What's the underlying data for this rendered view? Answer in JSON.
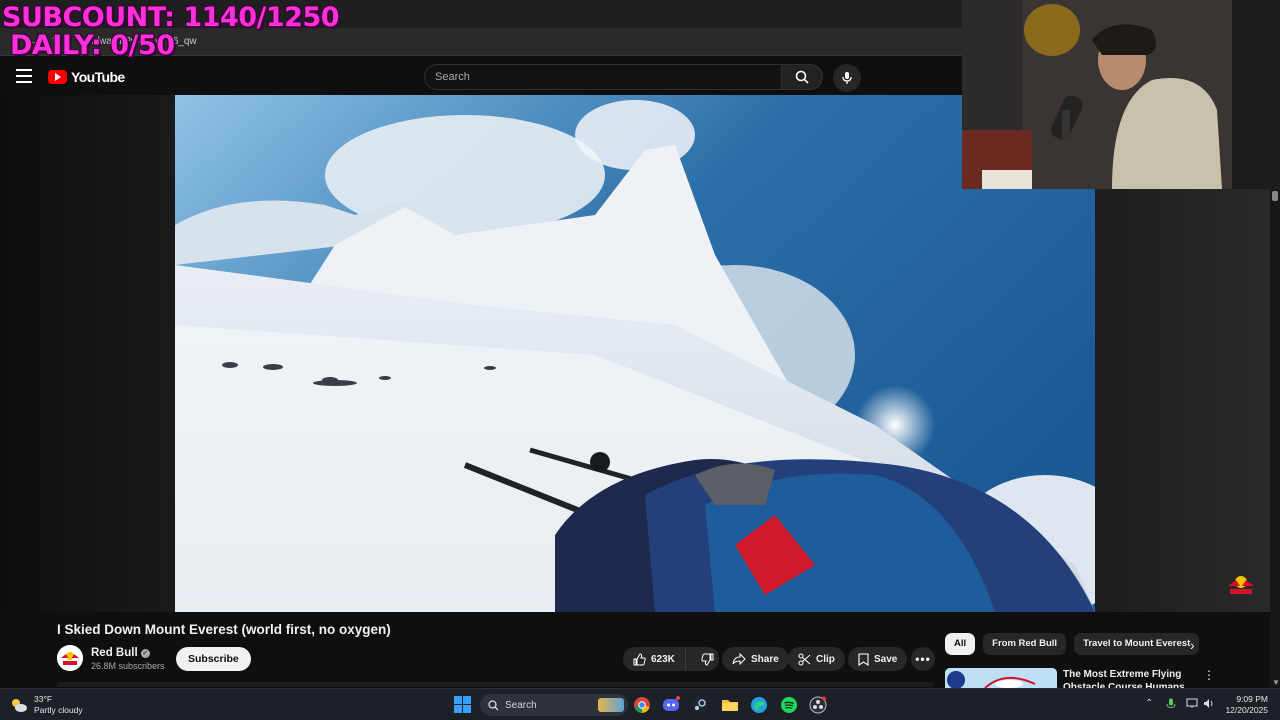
{
  "overlay": {
    "subcount": "SUBCOUNT: 1140/1250",
    "daily": "DAILY: 0/50"
  },
  "browser": {
    "url": "m/watch?v=cjZvFY6_qw"
  },
  "header": {
    "logo_text": "YouTube",
    "search_placeholder": "Search",
    "icons": [
      "menu-icon",
      "search-icon",
      "mic-icon"
    ]
  },
  "video": {
    "title": "I Skied Down Mount Everest (world first, no oxygen)",
    "channel": {
      "name": "Red Bull",
      "subscribers": "26.8M subscribers",
      "subscribe_label": "Subscribe",
      "verified": true
    },
    "actions": {
      "likes": "623K",
      "share": "Share",
      "clip": "Clip",
      "save": "Save"
    }
  },
  "sidebar": {
    "chips": [
      "All",
      "From Red Bull",
      "Travel to Mount Everest"
    ],
    "active_chip": "All",
    "recommendation": {
      "title": "The Most Extreme Flying Obstacle Course Humans Hav"
    }
  },
  "taskbar": {
    "weather_temp": "33°F",
    "weather_desc": "Partly cloudy",
    "search_label": "Search",
    "time": "9:09 PM",
    "date": "12/20/2025",
    "apps": [
      "windows-start-icon",
      "chrome-icon",
      "discord-icon",
      "steam-icon",
      "file-explorer-icon",
      "edge-icon",
      "spotify-icon",
      "obs-icon"
    ]
  },
  "colors": {
    "accent": "#ff0000",
    "overlay_text": "#ff2fd9",
    "background": "#0f0f0f"
  }
}
